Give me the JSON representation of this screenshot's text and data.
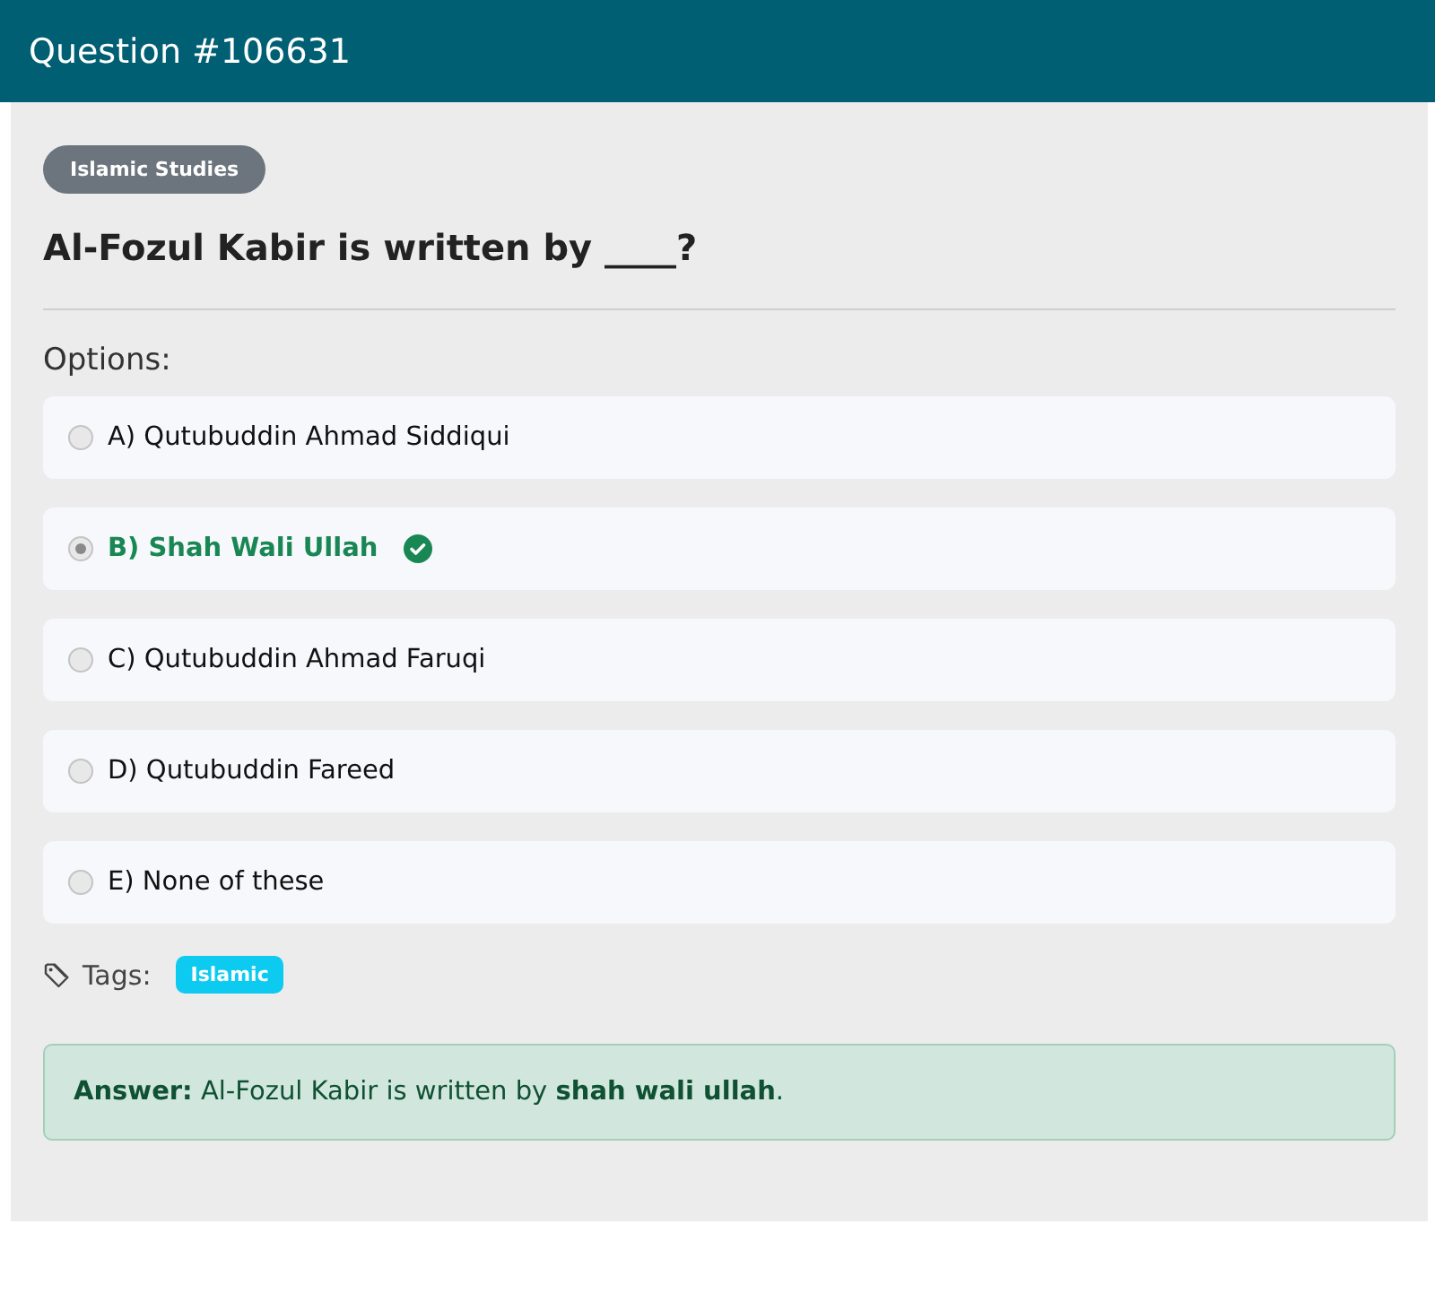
{
  "header": {
    "title": "Question #106631"
  },
  "category": "Islamic Studies",
  "question": "Al-Fozul Kabir is written by ____?",
  "options_label": "Options:",
  "options": [
    {
      "label": "A) Qutubuddin Ahmad Siddiqui",
      "selected": false,
      "correct": false
    },
    {
      "label": "B) Shah Wali Ullah",
      "selected": true,
      "correct": true
    },
    {
      "label": "C) Qutubuddin Ahmad Faruqi",
      "selected": false,
      "correct": false
    },
    {
      "label": "D) Qutubuddin Fareed",
      "selected": false,
      "correct": false
    },
    {
      "label": "E) None of these",
      "selected": false,
      "correct": false
    }
  ],
  "tags_label": "Tags:",
  "tags": [
    "Islamic"
  ],
  "answer": "**Answer:** Al-Fozul Kabir is written by **shah wali ullah**."
}
